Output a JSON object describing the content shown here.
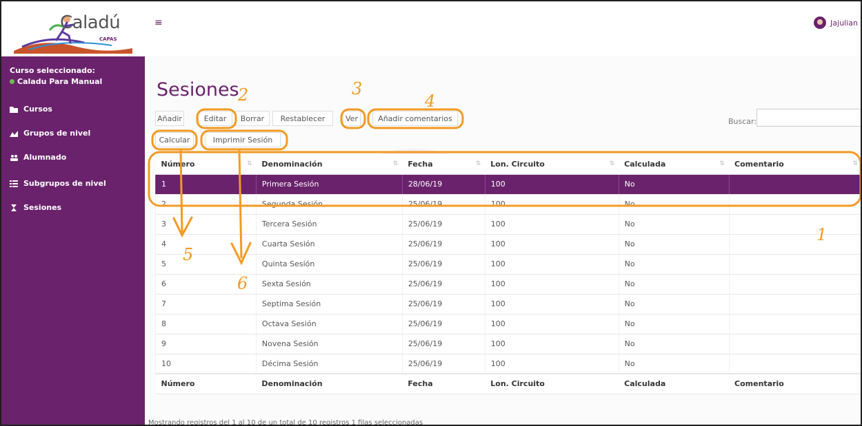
{
  "app": {
    "logo_text": "Caladú",
    "logo_sub": "CAPAS"
  },
  "sidebar": {
    "course_label": "Curso seleccionado:",
    "course_name": "Caladu Para Manual",
    "items": [
      {
        "label": "Cursos",
        "icon": "folder-icon"
      },
      {
        "label": "Grupos de nivel",
        "icon": "chart-icon"
      },
      {
        "label": "Alumnado",
        "icon": "users-icon"
      },
      {
        "label": "Subgrupos de nivel",
        "icon": "list-icon"
      },
      {
        "label": "Sesiones",
        "icon": "hourglass-icon"
      }
    ]
  },
  "topbar": {
    "user_name": "Jajulian"
  },
  "page": {
    "title": "Sesiones"
  },
  "toolbar": {
    "add": "Añadir",
    "edit": "Editar",
    "delete": "Borrar",
    "reset": "Restablecer",
    "view": "Ver",
    "add_comments": "Añadir comentarios",
    "calculate": "Calcular",
    "print_session": "Imprimir Sesión"
  },
  "search": {
    "label": "Buscar:",
    "value": ""
  },
  "table": {
    "columns": [
      "Número",
      "Denominación",
      "Fecha",
      "Lon. Circuito",
      "Calculada",
      "Comentario"
    ],
    "rows": [
      [
        "1",
        "Primera Sesión",
        "28/06/19",
        "100",
        "No",
        ""
      ],
      [
        "2",
        "Segunda Sesión",
        "25/06/19",
        "100",
        "No",
        ""
      ],
      [
        "3",
        "Tercera Sesión",
        "25/06/19",
        "100",
        "No",
        ""
      ],
      [
        "4",
        "Cuarta Sesión",
        "25/06/19",
        "100",
        "No",
        ""
      ],
      [
        "5",
        "Quinta Sesión",
        "25/06/19",
        "100",
        "No",
        ""
      ],
      [
        "6",
        "Sexta Sesión",
        "25/06/19",
        "100",
        "No",
        ""
      ],
      [
        "7",
        "Septima Sesión",
        "25/06/19",
        "100",
        "No",
        ""
      ],
      [
        "8",
        "Octava Sesión",
        "25/06/19",
        "100",
        "No",
        ""
      ],
      [
        "9",
        "Novena Sesión",
        "25/06/19",
        "100",
        "No",
        ""
      ],
      [
        "10",
        "Décima Sesión",
        "25/06/19",
        "100",
        "No",
        ""
      ]
    ],
    "selected_row": 0
  },
  "footer": {
    "info": "Mostrando registros del 1 al 10 de un total de 10 registros   1 filas seleccionadas"
  },
  "annotations": [
    "1",
    "2",
    "3",
    "4",
    "5",
    "6"
  ],
  "colors": {
    "brand": "#6a226c",
    "annotation": "#f29a23"
  }
}
